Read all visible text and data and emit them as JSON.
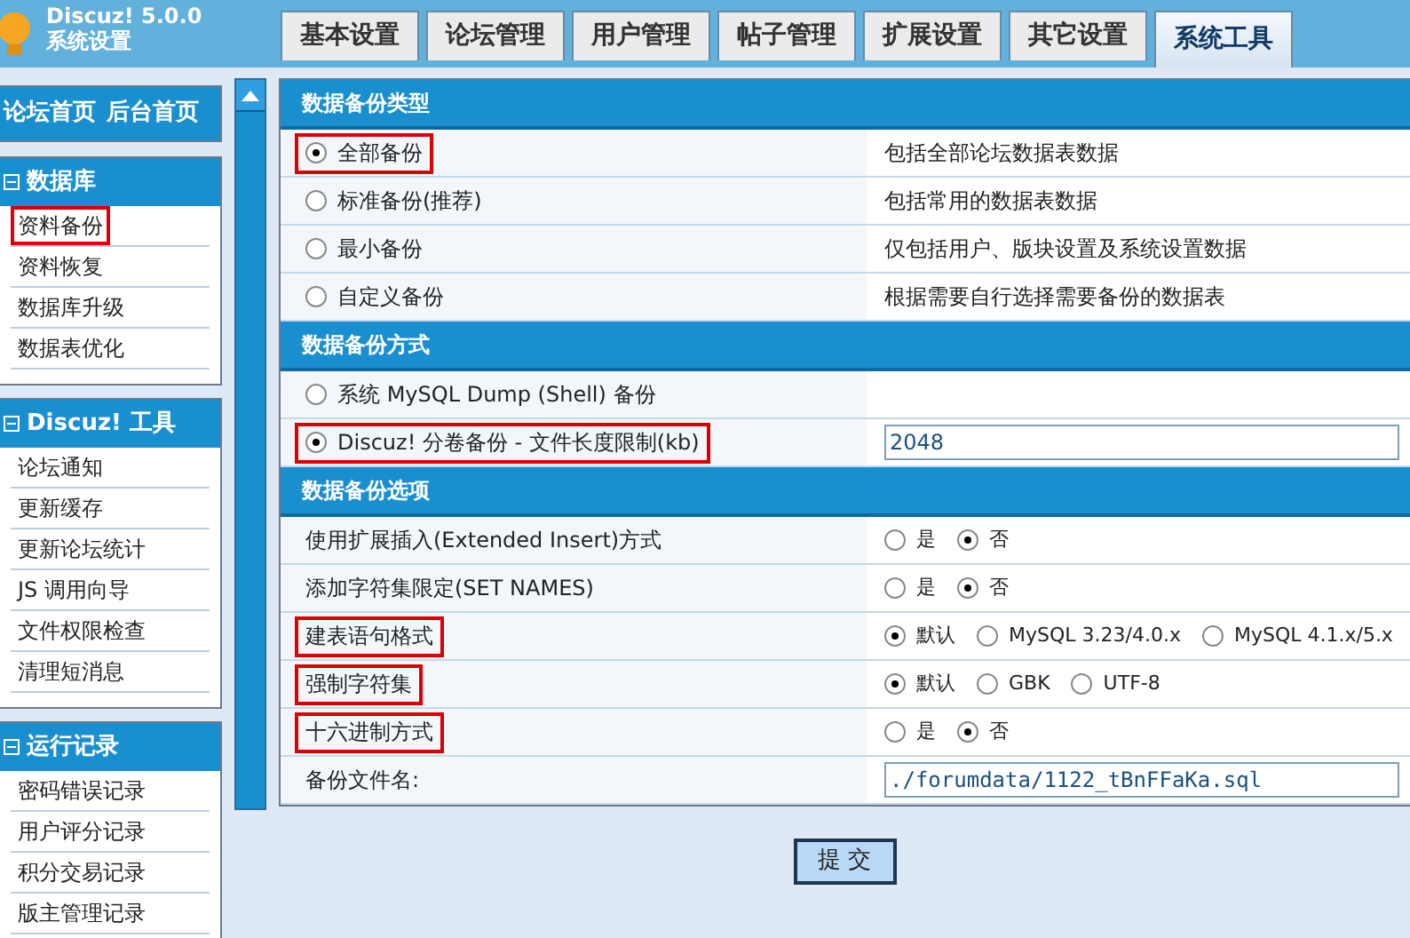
{
  "header": {
    "product": "Discuz! 5.0.0",
    "subtitle": "系统设置"
  },
  "tabs": [
    {
      "label": "基本设置",
      "selected": false
    },
    {
      "label": "论坛管理",
      "selected": false
    },
    {
      "label": "用户管理",
      "selected": false
    },
    {
      "label": "帖子管理",
      "selected": false
    },
    {
      "label": "扩展设置",
      "selected": false
    },
    {
      "label": "其它设置",
      "selected": false
    },
    {
      "label": "系统工具",
      "selected": true
    }
  ],
  "sidebar": {
    "home_links": [
      "论坛首页",
      "后台首页"
    ],
    "groups": [
      {
        "title": "数据库",
        "expanded": true,
        "items": [
          {
            "label": "资料备份",
            "highlighted": true
          },
          {
            "label": "资料恢复",
            "highlighted": false
          },
          {
            "label": "数据库升级",
            "highlighted": false
          },
          {
            "label": "数据表优化",
            "highlighted": false
          }
        ]
      },
      {
        "title": "Discuz! 工具",
        "expanded": true,
        "items": [
          {
            "label": "论坛通知",
            "highlighted": false
          },
          {
            "label": "更新缓存",
            "highlighted": false
          },
          {
            "label": "更新论坛统计",
            "highlighted": false
          },
          {
            "label": "JS 调用向导",
            "highlighted": false
          },
          {
            "label": "文件权限检查",
            "highlighted": false
          },
          {
            "label": "清理短消息",
            "highlighted": false
          }
        ]
      },
      {
        "title": "运行记录",
        "expanded": true,
        "items": [
          {
            "label": "密码错误记录",
            "highlighted": false
          },
          {
            "label": "用户评分记录",
            "highlighted": false
          },
          {
            "label": "积分交易记录",
            "highlighted": false
          },
          {
            "label": "版主管理记录",
            "highlighted": false
          }
        ]
      }
    ]
  },
  "sections": [
    {
      "title": "数据备份类型",
      "rows": [
        {
          "kind": "radio",
          "label": "全部备份",
          "selected": true,
          "highlighted": true,
          "description": "包括全部论坛数据表数据"
        },
        {
          "kind": "radio",
          "label": "标准备份(推荐)",
          "selected": false,
          "highlighted": false,
          "description": "包括常用的数据表数据"
        },
        {
          "kind": "radio",
          "label": "最小备份",
          "selected": false,
          "highlighted": false,
          "description": "仅包括用户、版块设置及系统设置数据"
        },
        {
          "kind": "radio",
          "label": "自定义备份",
          "selected": false,
          "highlighted": false,
          "description": "根据需要自行选择需要备份的数据表"
        }
      ]
    },
    {
      "title": "数据备份方式",
      "rows": [
        {
          "kind": "radio",
          "label": "系统  MySQL Dump (Shell) 备份",
          "selected": false,
          "highlighted": false
        },
        {
          "kind": "radio",
          "label": "Discuz! 分卷备份  - 文件长度限制(kb)",
          "selected": true,
          "highlighted": true,
          "value": "2048"
        }
      ]
    },
    {
      "title": "数据备份选项",
      "rows": [
        {
          "kind": "options",
          "label": "使用扩展插入(Extended Insert)方式",
          "highlighted": false,
          "options": [
            {
              "label": "是",
              "selected": false
            },
            {
              "label": "否",
              "selected": true
            }
          ]
        },
        {
          "kind": "options",
          "label": "添加字符集限定(SET NAMES)",
          "highlighted": false,
          "options": [
            {
              "label": "是",
              "selected": false
            },
            {
              "label": "否",
              "selected": true
            }
          ]
        },
        {
          "kind": "options",
          "label": "建表语句格式",
          "highlighted": true,
          "options": [
            {
              "label": "默认",
              "selected": true
            },
            {
              "label": "MySQL 3.23/4.0.x",
              "selected": false
            },
            {
              "label": "MySQL 4.1.x/5.x",
              "selected": false
            }
          ]
        },
        {
          "kind": "options",
          "label": "强制字符集",
          "highlighted": true,
          "options": [
            {
              "label": "默认",
              "selected": true
            },
            {
              "label": "GBK",
              "selected": false
            },
            {
              "label": "UTF-8",
              "selected": false
            }
          ]
        },
        {
          "kind": "options",
          "label": "十六进制方式",
          "highlighted": true,
          "options": [
            {
              "label": "是",
              "selected": false
            },
            {
              "label": "否",
              "selected": true
            }
          ]
        },
        {
          "kind": "text",
          "label": "备份文件名:",
          "highlighted": false,
          "value": "./forumdata/1122_tBnFFaKa.sql"
        }
      ]
    }
  ],
  "submit": "提 交"
}
